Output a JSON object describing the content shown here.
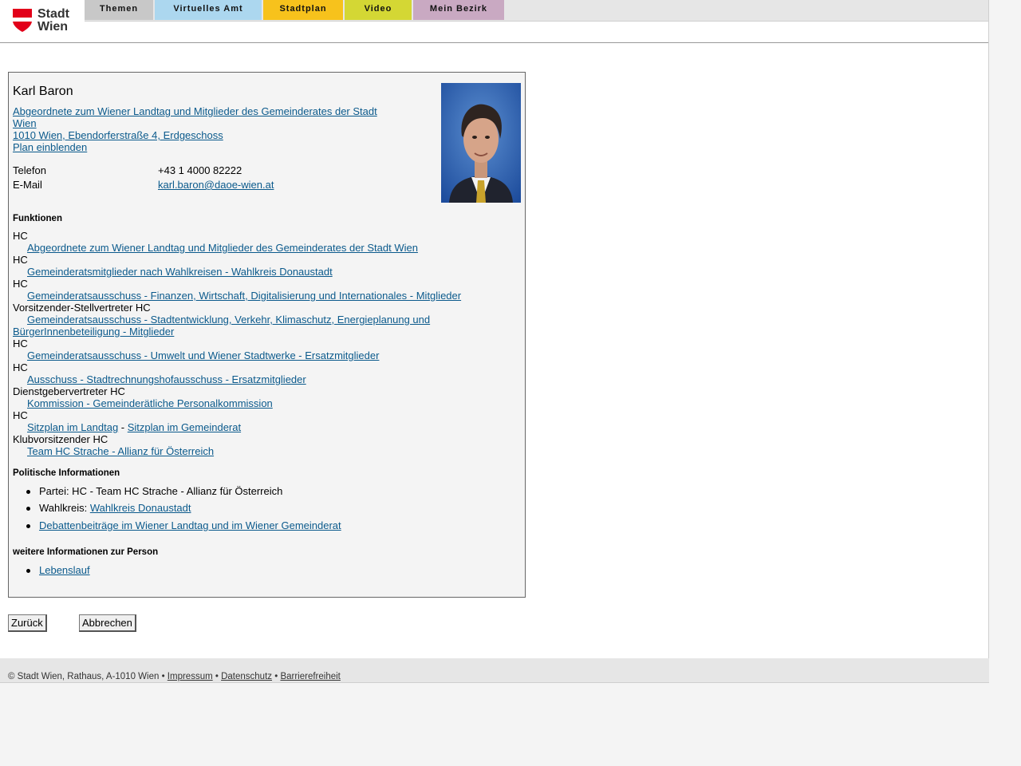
{
  "logo": {
    "line1": "Stadt",
    "line2": "Wien"
  },
  "nav": [
    {
      "label": "Themen",
      "color": "#c8c8c8"
    },
    {
      "label": "Virtuelles Amt",
      "color": "#acd7ef"
    },
    {
      "label": "Stadtplan",
      "color": "#f7c21c"
    },
    {
      "label": "Video",
      "color": "#d4d734"
    },
    {
      "label": "Mein Bezirk",
      "color": "#c9a9c2"
    }
  ],
  "person": {
    "name": "Karl Baron",
    "org_line1": "Abgeordnete zum Wiener Landtag und Mitglieder des Gemeinderates der Stadt",
    "org_line2": "Wien ",
    "address": "1010 Wien, Ebendorferstraße 4, Erdgeschoss",
    "plan": "Plan einblenden",
    "phone_label": "Telefon",
    "phone": "+43 1 4000 82222",
    "email_label": "E-Mail",
    "email": "karl.baron@daoe-wien.at"
  },
  "funktionen": {
    "title": "Funktionen",
    "items": [
      {
        "role": "HC",
        "link": "Abgeordnete zum Wiener Landtag und Mitglieder des Gemeinderates der Stadt Wien"
      },
      {
        "role": "HC",
        "link": "Gemeinderatsmitglieder nach Wahlkreisen - Wahlkreis Donaustadt"
      },
      {
        "role": "HC",
        "link": "Gemeinderatsausschuss - Finanzen, Wirtschaft, Digitalisierung und Internationales - Mitglieder"
      },
      {
        "role": "Vorsitzender-Stellvertreter HC",
        "link_line1": "Gemeinderatsausschuss - Stadtentwicklung, Verkehr, Klimaschutz, Energieplanung und",
        "link_line2": "BürgerInnenbeteiligung - Mitglieder"
      },
      {
        "role": "HC",
        "link": "Gemeinderatsausschuss - Umwelt und Wiener Stadtwerke - Ersatzmitglieder"
      },
      {
        "role": "HC",
        "link": "Ausschuss - Stadtrechnungshofausschuss - Ersatzmitglieder"
      },
      {
        "role": "Dienstgebervertreter HC",
        "link": "Kommission - Gemeinderätliche Personalkommission"
      },
      {
        "role": "HC",
        "link_a": "Sitzplan im Landtag",
        "sep": " - ",
        "link_b": "Sitzplan im Gemeinderat"
      },
      {
        "role": "Klubvorsitzender HC",
        "link": "Team HC Strache - Allianz für Österreich"
      }
    ]
  },
  "politik": {
    "title": "Politische Informationen",
    "partei": "Partei: HC - Team HC Strache - Allianz für Österreich",
    "wahlkreis_label": "Wahlkreis: ",
    "wahlkreis_link": "Wahlkreis Donaustadt",
    "debatten": "Debattenbeiträge im Wiener Landtag und im Wiener Gemeinderat"
  },
  "weitere": {
    "title": "weitere Informationen zur Person",
    "lebenslauf": "Lebenslauf"
  },
  "buttons": {
    "back": "Zurück",
    "cancel": "Abbrechen"
  },
  "footer": {
    "copyright": "© Stadt Wien, Rathaus, A-1010 Wien",
    "sep": " • ",
    "impressum": "Impressum",
    "datenschutz": "Datenschutz",
    "barrierefreiheit": "Barrierefreiheit"
  }
}
